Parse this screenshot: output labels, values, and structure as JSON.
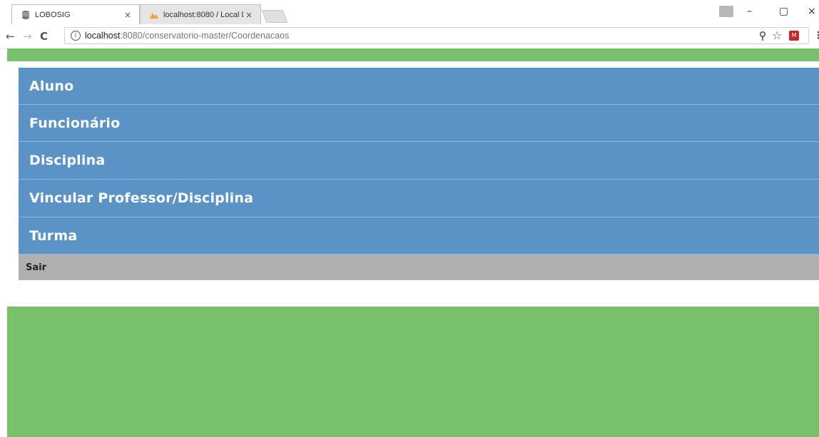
{
  "browser": {
    "tabs": [
      {
        "label": "LOBOSIG",
        "active": true,
        "favicon": "database-icon"
      },
      {
        "label": "localhost:8080 / Local Da",
        "active": false,
        "favicon": "phpmyadmin-icon"
      }
    ],
    "close_glyph": "×",
    "nav": {
      "back": "←",
      "forward": "→",
      "reload": "C"
    },
    "url_host": "localhost",
    "url_rest": ":8080/conservatorio-master/Coordenacaos",
    "window_controls": {
      "minimize": "–",
      "maximize": "▢",
      "close": "×"
    },
    "toolbar_icons": {
      "key": "key-icon",
      "star": "☆",
      "menu": "⋮"
    }
  },
  "theme": {
    "accent_green": "#78c06b",
    "menu_blue": "#5b93c6",
    "logout_gray": "#b0b0b0"
  },
  "menu": {
    "items": [
      {
        "label": "Aluno"
      },
      {
        "label": "Funcionário"
      },
      {
        "label": "Disciplina"
      },
      {
        "label": "Vincular Professor/Disciplina"
      },
      {
        "label": "Turma"
      }
    ],
    "logout": "Sair"
  }
}
